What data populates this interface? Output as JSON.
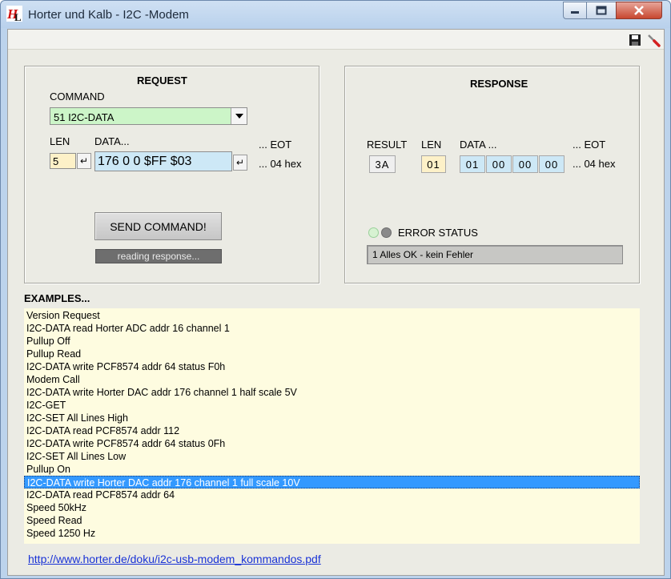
{
  "window": {
    "title": "Horter und Kalb - I2C -Modem"
  },
  "toolbar": {
    "icons": [
      "save-icon",
      "tools-icon"
    ]
  },
  "request": {
    "title": "REQUEST",
    "command_label": "COMMAND",
    "command_value": "51 I2C-DATA",
    "len_label": "LEN",
    "data_label": "DATA...",
    "eot_label": "... EOT",
    "eot_value": "... 04 hex",
    "len_value": "5",
    "data_value": "176 0 0 $FF $03",
    "enter_symbol": "↵",
    "send_label": "SEND COMMAND!",
    "progress_text": "reading response..."
  },
  "response": {
    "title": "RESPONSE",
    "result_label": "RESULT",
    "len_label": "LEN",
    "data_label": "DATA ...",
    "eot_label": "... EOT",
    "eot_value": "... 04 hex",
    "result_value": "3A",
    "len_value": "01",
    "data_bytes": [
      "01",
      "00",
      "00",
      "00"
    ],
    "error_label": "ERROR STATUS",
    "error_value": "1 Alles OK - kein Fehler"
  },
  "examples": {
    "title": "EXAMPLES...",
    "items": [
      "Version Request",
      "I2C-DATA read Horter ADC addr 16 channel 1",
      "Pullup Off",
      "Pullup Read",
      "I2C-DATA write PCF8574 addr 64 status F0h",
      "Modem Call",
      "I2C-DATA write Horter DAC addr 176 channel 1 half scale 5V",
      "I2C-GET",
      "I2C-SET All Lines High",
      "I2C-DATA read PCF8574 addr 112",
      "I2C-DATA write PCF8574 addr 64 status 0Fh",
      "I2C-SET All Lines Low",
      "Pullup On",
      "I2C-DATA write Horter DAC addr 176 channel 1 full scale 10V",
      "I2C-DATA read PCF8574 addr 64",
      "Speed 50kHz",
      "Speed Read",
      "Speed 1250 Hz"
    ],
    "selected_index": 13
  },
  "footer": {
    "link": "http://www.horter.de/doku/i2c-usb-modem_kommandos.pdf"
  },
  "colors": {
    "command_bg": "#ccf5c8",
    "data_bg": "#cde8f6",
    "len_bg": "#fdf1c8",
    "list_bg": "#fefce0",
    "selection": "#3399ff",
    "link": "#1a33d6"
  }
}
